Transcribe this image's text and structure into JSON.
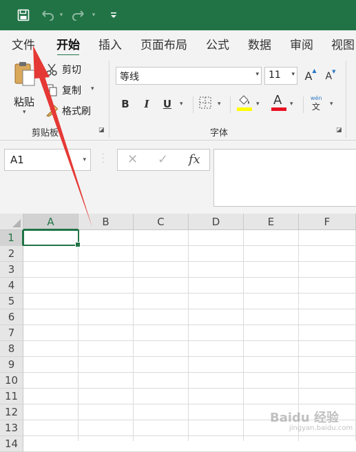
{
  "tabs": [
    "文件",
    "开始",
    "插入",
    "页面布局",
    "公式",
    "数据",
    "审阅",
    "视图"
  ],
  "active_tab": "开始",
  "clipboard": {
    "paste": "粘贴",
    "cut": "剪切",
    "copy": "复制",
    "format_painter": "格式刷",
    "group_label": "剪贴板"
  },
  "font": {
    "name": "等线",
    "size": "11",
    "group_label": "字体",
    "bold": "B",
    "italic": "I",
    "underline": "U",
    "font_color_glyph": "A",
    "increase_size": "A",
    "decrease_size": "A",
    "phonetic_top": "wén",
    "phonetic_bottom": "文",
    "highlight_color": "#ffff00",
    "font_color": "#e81123"
  },
  "formula_bar": {
    "name_box": "A1",
    "cancel": "✕",
    "enter": "✓",
    "fx": "fx",
    "formula": ""
  },
  "grid": {
    "columns": [
      "A",
      "B",
      "C",
      "D",
      "E",
      "F"
    ],
    "rows": [
      "1",
      "2",
      "3",
      "4",
      "5",
      "6",
      "7",
      "8",
      "9",
      "10",
      "11",
      "12",
      "13",
      "14"
    ],
    "selected_cell": "A1"
  },
  "colors": {
    "brand": "#217346",
    "annotation_arrow": "#e53935"
  },
  "watermark": {
    "main": "Baidu 经验",
    "sub": "jingyan.baidu.com"
  }
}
